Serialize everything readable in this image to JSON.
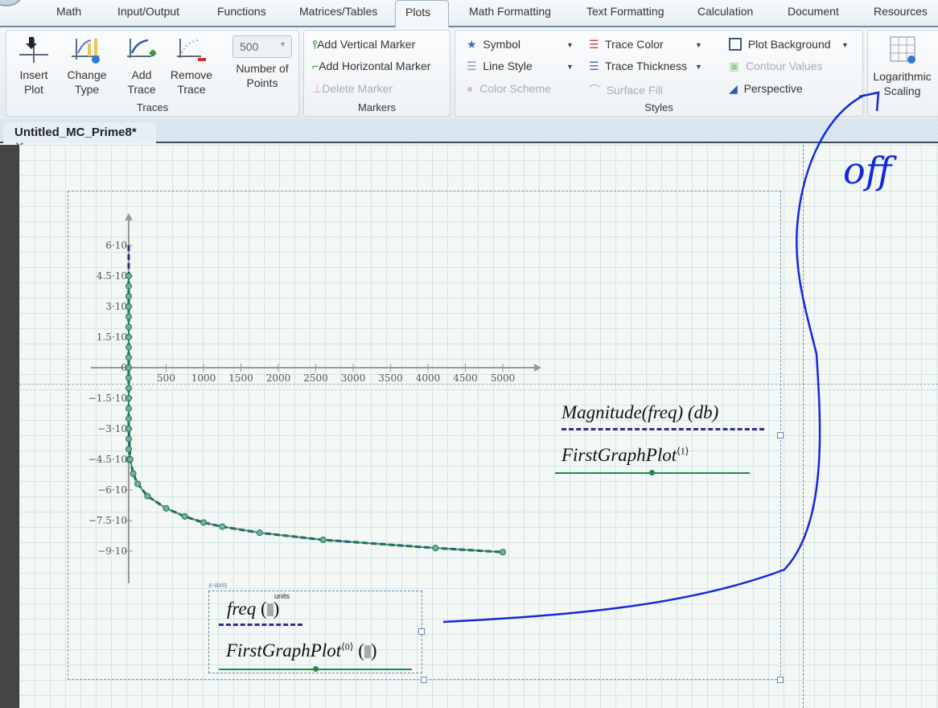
{
  "ribbon_tabs": [
    "Math",
    "Input/Output",
    "Functions",
    "Matrices/Tables",
    "Plots",
    "Math Formatting",
    "Text Formatting",
    "Calculation",
    "Document",
    "Resources"
  ],
  "active_tab": "Plots",
  "traces_group": {
    "label": "Traces",
    "insert_plot": "Insert Plot",
    "change_type": "Change Type",
    "add_trace": "Add Trace",
    "remove_trace": "Remove Trace",
    "num_points_value": "500",
    "num_points_label": "Number of Points"
  },
  "markers_group": {
    "label": "Markers",
    "add_vertical": "Add Vertical Marker",
    "add_horizontal": "Add Horizontal Marker",
    "delete": "Delete Marker"
  },
  "styles_group": {
    "label": "Styles",
    "symbol": "Symbol",
    "line_style": "Line Style",
    "color_scheme": "Color Scheme",
    "trace_color": "Trace Color",
    "trace_thickness": "Trace Thickness",
    "surface_fill": "Surface Fill",
    "plot_background": "Plot Background",
    "contour_values": "Contour Values",
    "perspective": "Perspective"
  },
  "log_scaling": "Logarithmic Scaling",
  "document_tab": "Untitled_MC_Prime8*",
  "plot": {
    "x_ticks": [
      "500",
      "1000",
      "1500",
      "2000",
      "2500",
      "3000",
      "3500",
      "4000",
      "4500",
      "5000"
    ],
    "y_ticks": [
      "6·10",
      "4.5·10",
      "3·10",
      "1.5·10",
      "0",
      "−1.5·10",
      "−3·10",
      "−4.5·10",
      "−6·10",
      "−7.5·10",
      "−9·10"
    ],
    "y_tick_values": [
      6,
      4.5,
      3,
      1.5,
      0,
      -1.5,
      -3,
      -4.5,
      -6,
      -7.5,
      -9
    ],
    "series_colors": {
      "magnitude": "#2e2f8a",
      "first_graph": "#1a8a4c"
    },
    "curve": [
      [
        0,
        6
      ],
      [
        0,
        4.5
      ],
      [
        0,
        3
      ],
      [
        0,
        1.5
      ],
      [
        0,
        0
      ],
      [
        0,
        -1.5
      ],
      [
        0,
        -3
      ],
      [
        20,
        -4.5
      ],
      [
        60,
        -5.2
      ],
      [
        120,
        -5.7
      ],
      [
        250,
        -6.3
      ],
      [
        500,
        -6.9
      ],
      [
        750,
        -7.3
      ],
      [
        1000,
        -7.6
      ],
      [
        1250,
        -7.8
      ],
      [
        1750,
        -8.1
      ],
      [
        2600,
        -8.45
      ],
      [
        4100,
        -8.85
      ],
      [
        5000,
        -9.05
      ]
    ],
    "y_legend": [
      {
        "expr": "Magnitude(freq) (db)"
      },
      {
        "expr": "FirstGraphPlot",
        "sup": "⟨1⟩"
      }
    ],
    "x_legend_label": "x-axis",
    "x_legend": [
      {
        "expr": "freq",
        "units": "units"
      },
      {
        "expr": "FirstGraphPlot",
        "sup": "⟨0⟩"
      }
    ]
  },
  "annotation": {
    "text": "off",
    "color": "#1428d8"
  }
}
